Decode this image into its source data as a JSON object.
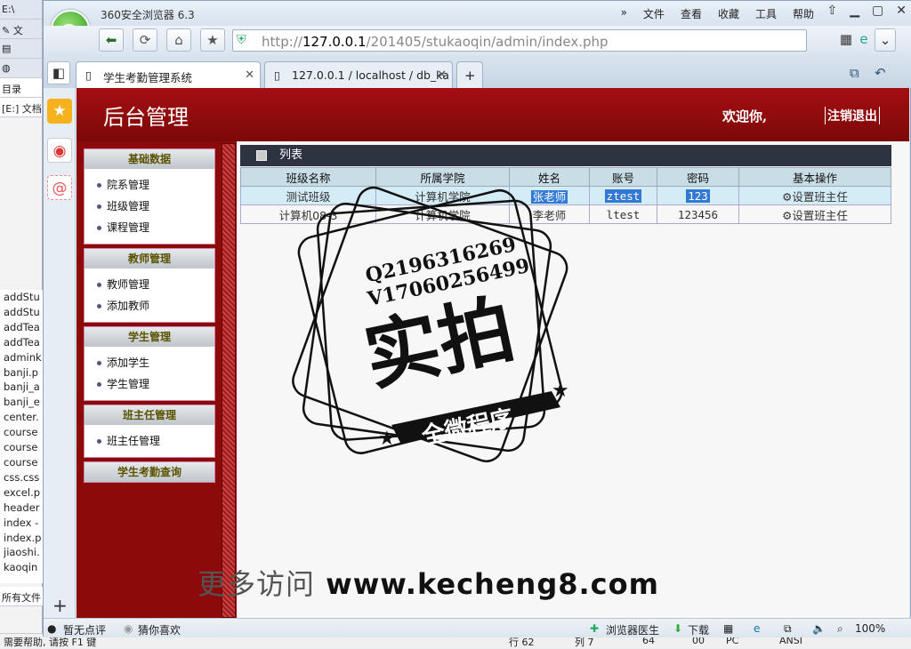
{
  "background_window": {
    "title": "E:\\",
    "toolbar_label": "文",
    "panel_tab": "目录",
    "path_label": "[E:] 文档",
    "files": [
      "addStu",
      "addStu",
      "addTea",
      "addTea",
      "admink",
      "banji.p",
      "banji_a",
      "banji_e",
      "center.",
      "course",
      "course",
      "course",
      "css.css",
      "excel.p",
      "header",
      "index -",
      "index.p",
      "jiaoshi.",
      "kaoqin"
    ],
    "filter_label": "所有文件",
    "status": {
      "help": "需要帮助, 请按 F1 键",
      "line": "行 62",
      "col": "列 7",
      "n1": "64",
      "n2": "00",
      "mode": "PC",
      "encoding": "ANSI"
    }
  },
  "browser": {
    "app_name": "360安全浏览器 6.3",
    "menu": [
      "文件",
      "查看",
      "收藏",
      "工具",
      "帮助"
    ],
    "url_prefix": "http://",
    "url_host": "127.0.0.1",
    "url_path": "/201405/stukaoqin/admin/index.php",
    "tabs": [
      {
        "label": "学生考勤管理系统"
      },
      {
        "label": "127.0.0.1 / localhost / db_ka"
      }
    ],
    "status": {
      "comment": "暂无点评",
      "guess": "猜你喜欢",
      "doctor": "浏览器医生",
      "download": "下载",
      "zoom": "100%"
    }
  },
  "page": {
    "title": "后台管理",
    "welcome": "欢迎你,",
    "logout": "注销退出",
    "nav_groups": [
      {
        "title": "基础数据",
        "items": [
          "院系管理",
          "班级管理",
          "课程管理"
        ]
      },
      {
        "title": "教师管理",
        "items": [
          "教师管理",
          "添加教师"
        ]
      },
      {
        "title": "学生管理",
        "items": [
          "添加学生",
          "学生管理"
        ]
      },
      {
        "title": "班主任管理",
        "items": [
          "班主任管理"
        ]
      },
      {
        "title": "学生考勤查询",
        "items": []
      }
    ],
    "list_title": "列表",
    "table": {
      "headers": [
        "班级名称",
        "所属学院",
        "姓名",
        "账号",
        "密码",
        "基本操作"
      ],
      "rows": [
        [
          "测试班级",
          "计算机学院",
          "张老师",
          "ztest",
          "123",
          "设置班主任"
        ],
        [
          "计算机08-3",
          "计算机学院",
          "李老师",
          "ltest",
          "123456",
          "设置班主任"
        ]
      ]
    }
  },
  "watermark": {
    "qq": "Q2196316269",
    "wechat": "V17060256499",
    "big": "实拍",
    "ribbon": "全微程序",
    "site_cn": "更多访问",
    "site": "www.kecheng8.com"
  }
}
